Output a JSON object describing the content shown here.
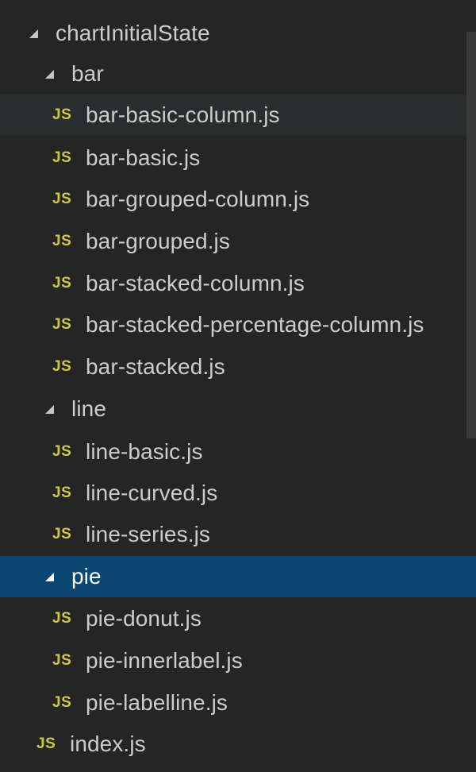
{
  "tree": {
    "root_folder": "chartInitialState",
    "bar": {
      "label": "bar",
      "files": [
        "bar-basic-column.js",
        "bar-basic.js",
        "bar-grouped-column.js",
        "bar-grouped.js",
        "bar-stacked-column.js",
        "bar-stacked-percentage-column.js",
        "bar-stacked.js"
      ]
    },
    "line": {
      "label": "line",
      "files": [
        "line-basic.js",
        "line-curved.js",
        "line-series.js"
      ]
    },
    "pie": {
      "label": "pie",
      "files": [
        "pie-donut.js",
        "pie-innerlabel.js",
        "pie-labelline.js"
      ]
    },
    "root_file": "index.js"
  },
  "icon_text": "JS",
  "icons": {
    "file": "javascript-file-icon",
    "folder": "expanded-twistie-icon"
  },
  "colors": {
    "background": "#252526",
    "selected": "#094771",
    "hover": "#2a2d2e",
    "js_icon": "#cbcb41",
    "text": "#cccccc"
  }
}
